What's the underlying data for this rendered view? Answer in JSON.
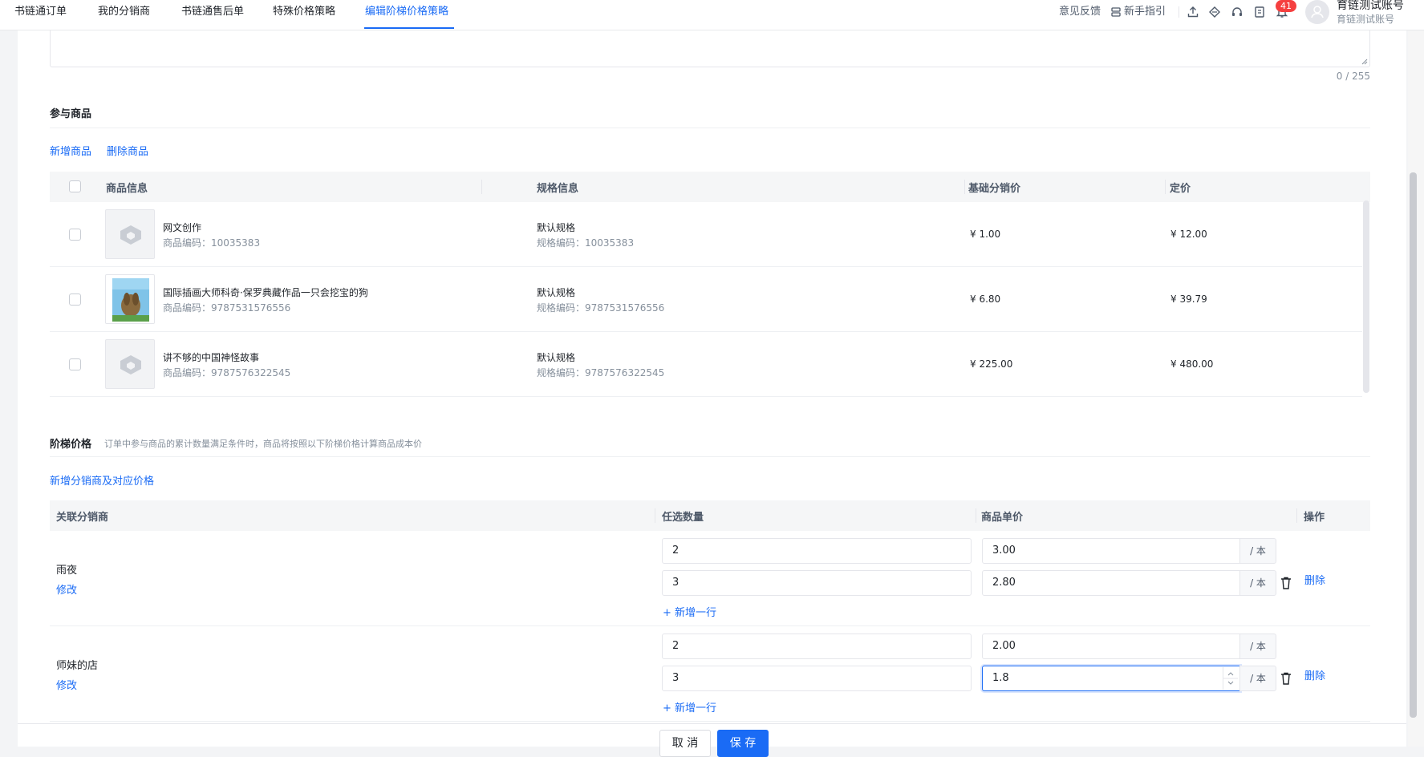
{
  "nav": {
    "tabs": [
      "书链通订单",
      "我的分销商",
      "书链通售后单",
      "特殊价格策略",
      "编辑阶梯价格策略"
    ],
    "feedback": "意见反馈",
    "guide": "新手指引",
    "notification_count": "41",
    "user_name": "育链测试账号",
    "user_sub": "育链测试账号"
  },
  "desc": {
    "counter": "0 / 255"
  },
  "products": {
    "title": "参与商品",
    "add": "新增商品",
    "remove": "删除商品",
    "headers": [
      "商品信息",
      "规格信息",
      "基础分销价",
      "定价"
    ],
    "rows": [
      {
        "name": "网文创作",
        "code": "商品编码：10035383",
        "spec": "默认规格",
        "spec_code": "规格编码：10035383",
        "base_price": "¥ 1.00",
        "price": "¥ 12.00"
      },
      {
        "name": "国际插画大师科奇·保罗典藏作品一只会挖宝的狗",
        "code": "商品编码：9787531576556",
        "spec": "默认规格",
        "spec_code": "规格编码：9787531576556",
        "base_price": "¥ 6.80",
        "price": "¥ 39.79"
      },
      {
        "name": "讲不够的中国神怪故事",
        "code": "商品编码：9787576322545",
        "spec": "默认规格",
        "spec_code": "规格编码：9787576322545",
        "base_price": "¥ 225.00",
        "price": "¥ 480.00"
      }
    ]
  },
  "tier": {
    "title": "阶梯价格",
    "desc": "订单中参与商品的累计数量满足条件时，商品将按照以下阶梯价格计算商品成本价",
    "add_distributor": "新增分销商及对应价格",
    "headers": [
      "关联分销商",
      "任选数量",
      "商品单价",
      "操作"
    ],
    "unit": "/ 本",
    "add_row": "+ 新增一行",
    "edit": "修改",
    "delete": "删除",
    "groups": [
      {
        "distributor": "雨夜",
        "rows": [
          {
            "qty": "2",
            "price": "3.00"
          },
          {
            "qty": "3",
            "price": "2.80"
          }
        ]
      },
      {
        "distributor": "师妹的店",
        "rows": [
          {
            "qty": "2",
            "price": "2.00"
          },
          {
            "qty": "3",
            "price": "1.8"
          }
        ]
      }
    ]
  },
  "footer": {
    "cancel": "取 消",
    "save": "保 存"
  }
}
